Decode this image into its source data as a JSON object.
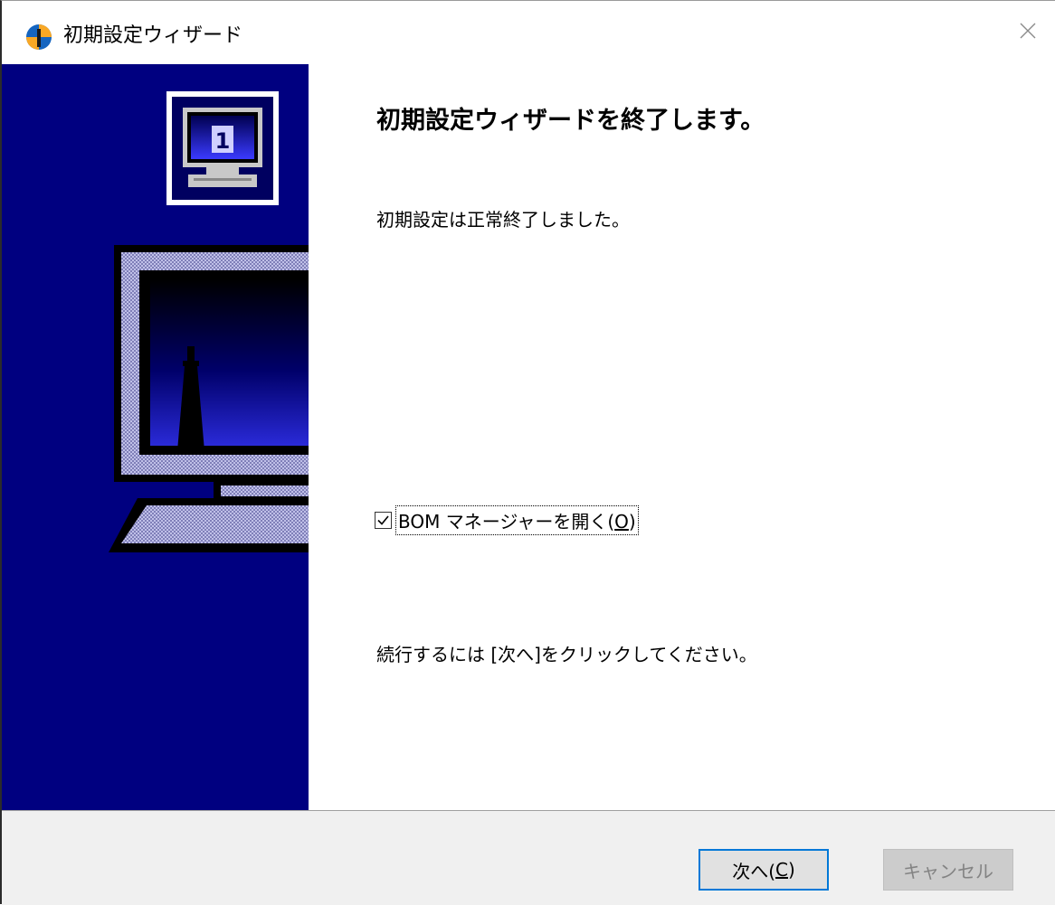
{
  "window": {
    "title": "初期設定ウィザード",
    "accent_color": "#0078d7",
    "banner_color": "#000080"
  },
  "main": {
    "heading": "初期設定ウィザードを終了します。",
    "message": "初期設定は正常終了しました。",
    "checkbox": {
      "label": "BOM マネージャーを開く(",
      "mnemonic": "O",
      "suffix": ")",
      "checked": true
    },
    "instruction": "続行するには [次へ]をクリックしてください。"
  },
  "banner": {
    "badge_number": "1"
  },
  "footer": {
    "next": {
      "label": "次へ(",
      "mnemonic": "C",
      "suffix": ")"
    },
    "cancel": {
      "label": "キャンセル",
      "disabled": true
    }
  }
}
